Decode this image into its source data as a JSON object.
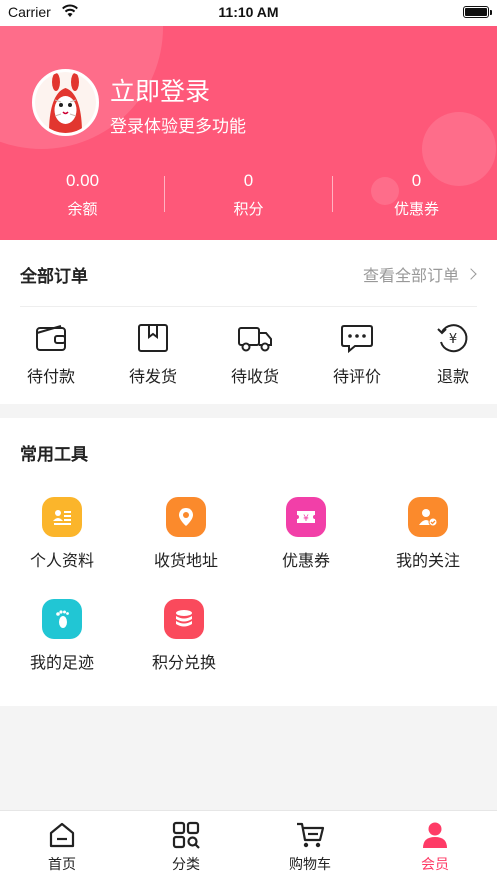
{
  "status_bar": {
    "carrier": "Carrier",
    "time": "11:10 AM"
  },
  "profile": {
    "login_title": "立即登录",
    "login_subtitle": "登录体验更多功能"
  },
  "stats": [
    {
      "value": "0.00",
      "label": "余额"
    },
    {
      "value": "0",
      "label": "积分"
    },
    {
      "value": "0",
      "label": "优惠券"
    }
  ],
  "orders": {
    "title": "全部订单",
    "view_all": "查看全部订单",
    "items": [
      {
        "label": "待付款",
        "icon": "wallet-icon"
      },
      {
        "label": "待发货",
        "icon": "package-icon"
      },
      {
        "label": "待收货",
        "icon": "truck-icon"
      },
      {
        "label": "待评价",
        "icon": "comment-icon"
      },
      {
        "label": "退款",
        "icon": "refund-icon"
      }
    ]
  },
  "tools": {
    "title": "常用工具",
    "items": [
      {
        "label": "个人资料",
        "icon": "profile-card-icon",
        "color": "#fbb52b"
      },
      {
        "label": "收货地址",
        "icon": "location-pin-icon",
        "color": "#fb8a2c"
      },
      {
        "label": "优惠券",
        "icon": "coupon-icon",
        "color": "#f23fa8"
      },
      {
        "label": "我的关注",
        "icon": "follow-user-icon",
        "color": "#fb8a2c"
      },
      {
        "label": "我的足迹",
        "icon": "footprint-icon",
        "color": "#21c6d4"
      },
      {
        "label": "积分兑换",
        "icon": "points-stack-icon",
        "color": "#fa4a5c"
      }
    ]
  },
  "tabs": [
    {
      "label": "首页",
      "icon": "home-icon",
      "active": false
    },
    {
      "label": "分类",
      "icon": "category-icon",
      "active": false
    },
    {
      "label": "购物车",
      "icon": "cart-icon",
      "active": false
    },
    {
      "label": "会员",
      "icon": "member-icon",
      "active": true
    }
  ],
  "colors": {
    "brand": "#fe5879",
    "active_tab": "#fe3b66"
  }
}
